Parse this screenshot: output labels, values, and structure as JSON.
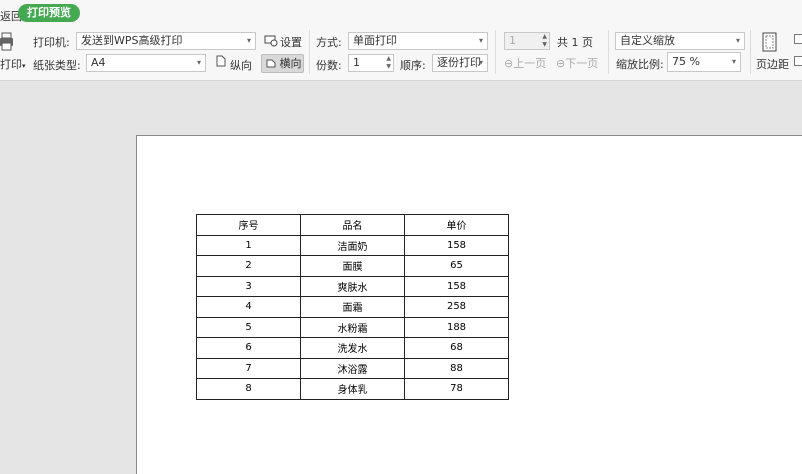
{
  "tabbar": {
    "back_label": "返回",
    "active_tab": "打印预览"
  },
  "printer": {
    "menu_label": "打印",
    "printer_label": "打印机:",
    "printer_value": "发送到WPS高级打印",
    "settings_label": "设置"
  },
  "paper": {
    "type_label": "纸张类型:",
    "type_value": "A4",
    "portrait_label": "纵向",
    "landscape_label": "横向"
  },
  "mode": {
    "label": "方式:",
    "value": "单面打印",
    "copies_label": "份数:",
    "copies_value": "1",
    "order_label": "顺序:",
    "order_value": "逐份打印"
  },
  "pages": {
    "current_value": "1",
    "total_text": "共 1 页",
    "prev_label": "上一页",
    "next_label": "下一页"
  },
  "zoom": {
    "mode_value": "自定义缩放",
    "ratio_label": "缩放比例:",
    "ratio_value": "75 %"
  },
  "margins": {
    "label": "页边距"
  },
  "table": {
    "headers": [
      "序号",
      "品名",
      "单价"
    ],
    "rows": [
      [
        "1",
        "洁面奶",
        "158"
      ],
      [
        "2",
        "面膜",
        "65"
      ],
      [
        "3",
        "爽肤水",
        "158"
      ],
      [
        "4",
        "面霜",
        "258"
      ],
      [
        "5",
        "水粉霜",
        "188"
      ],
      [
        "6",
        "洗发水",
        "68"
      ],
      [
        "7",
        "沐浴露",
        "88"
      ],
      [
        "8",
        "身体乳",
        "78"
      ]
    ]
  },
  "colors": {
    "accent": "#45a952",
    "ribbon_bg": "#f7f7f7",
    "workspace_bg": "#e5e5e5"
  }
}
